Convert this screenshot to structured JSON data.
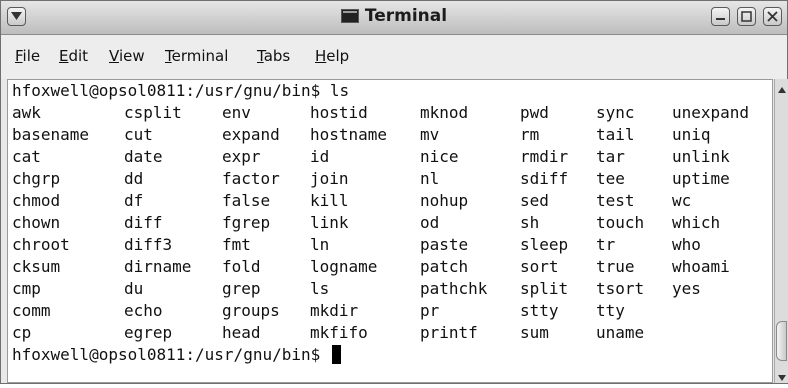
{
  "window": {
    "title": "Terminal"
  },
  "menubar": {
    "items": [
      {
        "mnemonic": "F",
        "rest": "ile"
      },
      {
        "mnemonic": "E",
        "rest": "dit"
      },
      {
        "mnemonic": "V",
        "rest": "iew"
      },
      {
        "mnemonic": "T",
        "rest": "erminal"
      },
      {
        "mnemonic": "T",
        "rest": "abs"
      },
      {
        "mnemonic": "H",
        "rest": "elp"
      }
    ]
  },
  "terminal": {
    "prompt": "hfoxwell@opsol0811:/usr/gnu/bin$ ",
    "command": "ls",
    "rows": [
      [
        "awk",
        "csplit",
        "env",
        "hostid",
        "mknod",
        "pwd",
        "sync",
        "unexpand"
      ],
      [
        "basename",
        "cut",
        "expand",
        "hostname",
        "mv",
        "rm",
        "tail",
        "uniq"
      ],
      [
        "cat",
        "date",
        "expr",
        "id",
        "nice",
        "rmdir",
        "tar",
        "unlink"
      ],
      [
        "chgrp",
        "dd",
        "factor",
        "join",
        "nl",
        "sdiff",
        "tee",
        "uptime"
      ],
      [
        "chmod",
        "df",
        "false",
        "kill",
        "nohup",
        "sed",
        "test",
        "wc"
      ],
      [
        "chown",
        "diff",
        "fgrep",
        "link",
        "od",
        "sh",
        "touch",
        "which"
      ],
      [
        "chroot",
        "diff3",
        "fmt",
        "ln",
        "paste",
        "sleep",
        "tr",
        "who"
      ],
      [
        "cksum",
        "dirname",
        "fold",
        "logname",
        "patch",
        "sort",
        "true",
        "whoami"
      ],
      [
        "cmp",
        "du",
        "grep",
        "ls",
        "pathchk",
        "split",
        "tsort",
        "yes"
      ],
      [
        "comm",
        "echo",
        "groups",
        "mkdir",
        "pr",
        "stty",
        "tty",
        ""
      ],
      [
        "cp",
        "egrep",
        "head",
        "mkfifo",
        "printf",
        "sum",
        "uname",
        ""
      ]
    ],
    "final_prompt": "hfoxwell@opsol0811:/usr/gnu/bin$ "
  },
  "icons": {
    "window_menu": "window-menu-icon",
    "terminal": "terminal-icon",
    "minimize": "minimize-icon",
    "maximize": "maximize-icon",
    "close": "close-icon",
    "scroll_up": "scroll-up-arrow-icon",
    "scroll_down": "scroll-down-arrow-icon"
  }
}
